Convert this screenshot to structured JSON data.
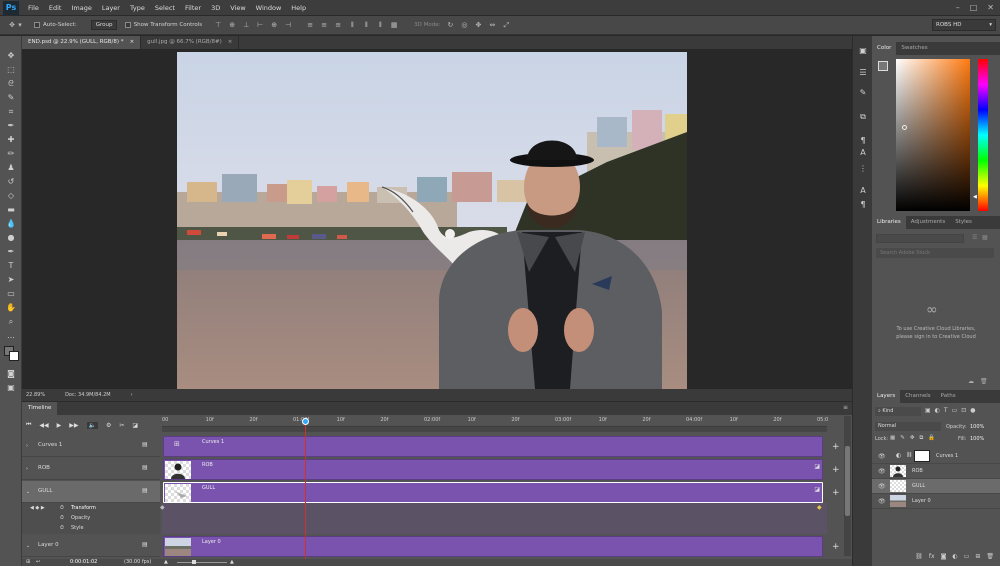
{
  "menubar": {
    "logo": "Ps",
    "items": [
      "File",
      "Edit",
      "Image",
      "Layer",
      "Type",
      "Select",
      "Filter",
      "3D",
      "View",
      "Window",
      "Help"
    ]
  },
  "options": {
    "auto_select": "Auto-Select:",
    "auto_select_value": "Group",
    "show_transform": "Show Transform Controls",
    "mode_3d": "3D Mode:",
    "workspace": "ROBS HD"
  },
  "tabs": [
    {
      "label": "END.psd @ 22.9% (GULL, RGB/8) *",
      "close": "×"
    },
    {
      "label": "gull.jpg @ 66.7% (RGB/8#)",
      "close": "×"
    }
  ],
  "status": {
    "zoom": "22.89%",
    "doc": "Doc: 34.9M/84.2M",
    "arrow": "›"
  },
  "panels": {
    "color_tabs": [
      "Color",
      "Swatches"
    ],
    "lib_tabs": [
      "Libraries",
      "Adjustments",
      "Styles"
    ],
    "lib_message": "To use Creative Cloud Libraries, please sign in to Creative Cloud",
    "lib_search": "Search Adobe Stock",
    "layers_tabs": [
      "Layers",
      "Channels",
      "Paths"
    ],
    "kind": "Kind",
    "blend": "Normal",
    "opacity_label": "Opacity:",
    "opacity": "100%",
    "lock_label": "Lock:",
    "fill_label": "Fill:",
    "fill": "100%",
    "layers": [
      {
        "name": "Curves 1"
      },
      {
        "name": "ROB"
      },
      {
        "name": "GULL"
      },
      {
        "name": "Layer 0"
      }
    ]
  },
  "timeline": {
    "title": "Timeline",
    "ruler": [
      "00",
      "10f",
      "20f",
      "01:00f",
      "10f",
      "20f",
      "02:00f",
      "10f",
      "20f",
      "03:00f",
      "10f",
      "20f",
      "04:00f",
      "10f",
      "20f",
      "05:0"
    ],
    "tracks": [
      {
        "name": "Curves 1",
        "clip": "Curves 1"
      },
      {
        "name": "ROB",
        "clip": "ROB"
      },
      {
        "name": "GULL",
        "clip": "GULL"
      },
      {
        "name": "Layer 0",
        "clip": "Layer 0"
      }
    ],
    "props": [
      "Transform",
      "Opacity",
      "Style"
    ],
    "timecode": "0:00:01:02",
    "fps": "(30.00 fps)"
  },
  "colors": {
    "clip": "#7a53ae",
    "playhead": "#d0312d",
    "accent": "#31a8ff"
  }
}
